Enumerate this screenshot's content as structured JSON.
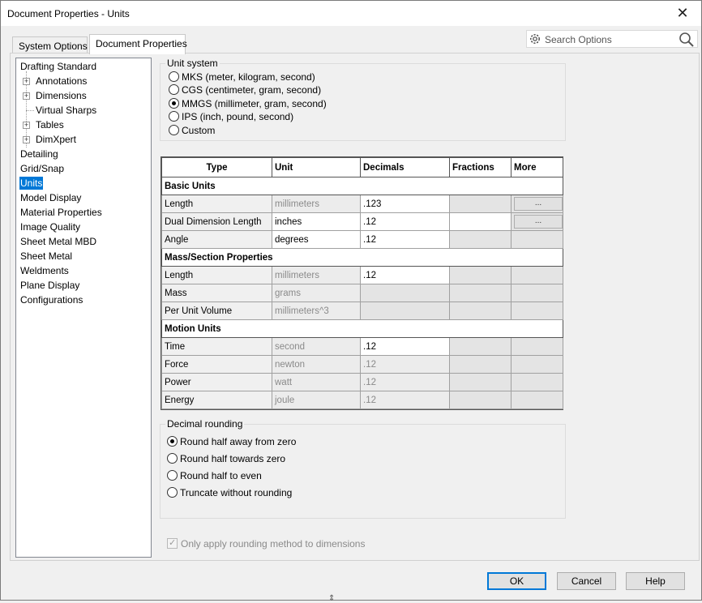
{
  "window": {
    "title": "Document Properties - Units"
  },
  "tabs": [
    {
      "label": "System Options"
    },
    {
      "label": "Document Properties"
    }
  ],
  "search": {
    "placeholder": "Search Options",
    "icon": "search-icon"
  },
  "tree": {
    "items": [
      {
        "label": "Drafting Standard"
      },
      {
        "label": "Annotations"
      },
      {
        "label": "Dimensions"
      },
      {
        "label": "Virtual Sharps"
      },
      {
        "label": "Tables"
      },
      {
        "label": "DimXpert"
      },
      {
        "label": "Detailing"
      },
      {
        "label": "Grid/Snap"
      },
      {
        "label": "Units"
      },
      {
        "label": "Model Display"
      },
      {
        "label": "Material Properties"
      },
      {
        "label": "Image Quality"
      },
      {
        "label": "Sheet Metal MBD"
      },
      {
        "label": "Sheet Metal"
      },
      {
        "label": "Weldments"
      },
      {
        "label": "Plane Display"
      },
      {
        "label": "Configurations"
      }
    ],
    "selected": "Units"
  },
  "unit_system": {
    "legend": "Unit system",
    "options": [
      {
        "label": "MKS  (meter, kilogram, second)",
        "checked": false
      },
      {
        "label": "CGS  (centimeter, gram, second)",
        "checked": false
      },
      {
        "label": "MMGS (millimeter, gram, second)",
        "checked": true
      },
      {
        "label": "IPS  (inch, pound, second)",
        "checked": false
      },
      {
        "label": "Custom",
        "checked": false
      }
    ]
  },
  "units_table": {
    "headers": {
      "type": "Type",
      "unit": "Unit",
      "decimals": "Decimals",
      "fractions": "Fractions",
      "more": "More"
    },
    "sections": {
      "basic": "Basic Units",
      "mass": "Mass/Section Properties",
      "motion": "Motion Units"
    },
    "basic_rows": [
      {
        "type": "Length",
        "unit": "millimeters",
        "decimals": ".123",
        "more": "..."
      },
      {
        "type": "Dual Dimension Length",
        "unit": "inches",
        "decimals": ".12",
        "more": "..."
      },
      {
        "type": "Angle",
        "unit": "degrees",
        "decimals": ".12"
      }
    ],
    "mass_rows": [
      {
        "type": "Length",
        "unit": "millimeters",
        "decimals": ".12"
      },
      {
        "type": "Mass",
        "unit": "grams",
        "decimals": ""
      },
      {
        "type": "Per Unit Volume",
        "unit": "millimeters^3",
        "decimals": ""
      }
    ],
    "motion_rows": [
      {
        "type": "Time",
        "unit": "second",
        "decimals": ".12"
      },
      {
        "type": "Force",
        "unit": "newton",
        "decimals": ".12"
      },
      {
        "type": "Power",
        "unit": "watt",
        "decimals": ".12"
      },
      {
        "type": "Energy",
        "unit": "joule",
        "decimals": ".12"
      }
    ]
  },
  "decimal_rounding": {
    "legend": "Decimal rounding",
    "options": [
      {
        "label": "Round half away from zero",
        "checked": true
      },
      {
        "label": "Round half towards zero",
        "checked": false
      },
      {
        "label": "Round half to even",
        "checked": false
      },
      {
        "label": "Truncate without rounding",
        "checked": false
      }
    ]
  },
  "only_apply_rounding": {
    "label": "Only apply rounding method to dimensions",
    "checked": true,
    "enabled": false
  },
  "buttons": {
    "ok": "OK",
    "cancel": "Cancel",
    "help": "Help"
  },
  "colors": {
    "selection": "#0078d7",
    "default_button_border": "#0078d7"
  }
}
